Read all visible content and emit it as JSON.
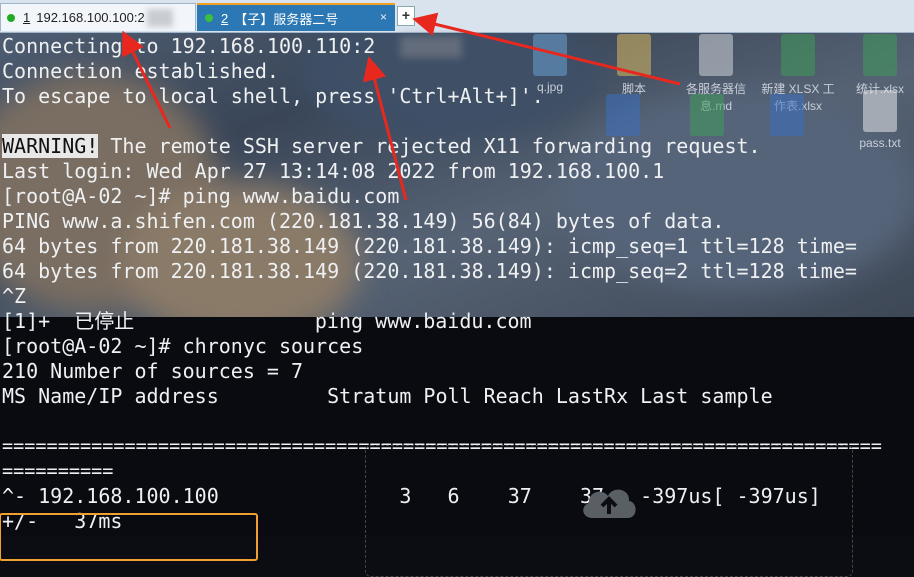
{
  "tabs": [
    {
      "index": "1",
      "label": "192.168.100.100:2",
      "status_color": "#22aa22",
      "active": false
    },
    {
      "index": "2",
      "label": "【子】服务器二号",
      "status_color": "#3c8f3c",
      "active": true
    }
  ],
  "new_tab_symbol": "+",
  "close_symbol": "×",
  "desktop_icons": [
    "q.jpg",
    "脚本",
    "各服务器信息.md",
    "新建 XLSX 工作表.xlsx",
    "统计.xlsx",
    "pass.txt"
  ],
  "terminal": {
    "lines": [
      "Connecting to 192.168.100.110:2",
      "Connection established.",
      "To escape to local shell, press 'Ctrl+Alt+]'.",
      "",
      " The remote SSH server rejected X11 forwarding request.",
      "Last login: Wed Apr 27 13:14:08 2022 from 192.168.100.1",
      "[root@A-02 ~]# ping www.baidu.com",
      "PING www.a.shifen.com (220.181.38.149) 56(84) bytes of data.",
      "64 bytes from 220.181.38.149 (220.181.38.149): icmp_seq=1 ttl=128 time=",
      "64 bytes from 220.181.38.149 (220.181.38.149): icmp_seq=2 ttl=128 time=",
      "^Z",
      "[1]+  已停止               ping www.baidu.com",
      "[root@A-02 ~]# chronyc sources",
      "210 Number of sources = 7",
      "MS Name/IP address         Stratum Poll Reach LastRx Last sample",
      "",
      "===============================================================================",
      "==========",
      "^- 192.168.100.100               3   6    37    37   -397us[ -397us]",
      "+/-   37ms"
    ],
    "warning_label": "WARNING!"
  },
  "colors": {
    "tab_active": "#2b78b5",
    "highlight_box": "#f0a030",
    "arrow": "#e8281e"
  }
}
